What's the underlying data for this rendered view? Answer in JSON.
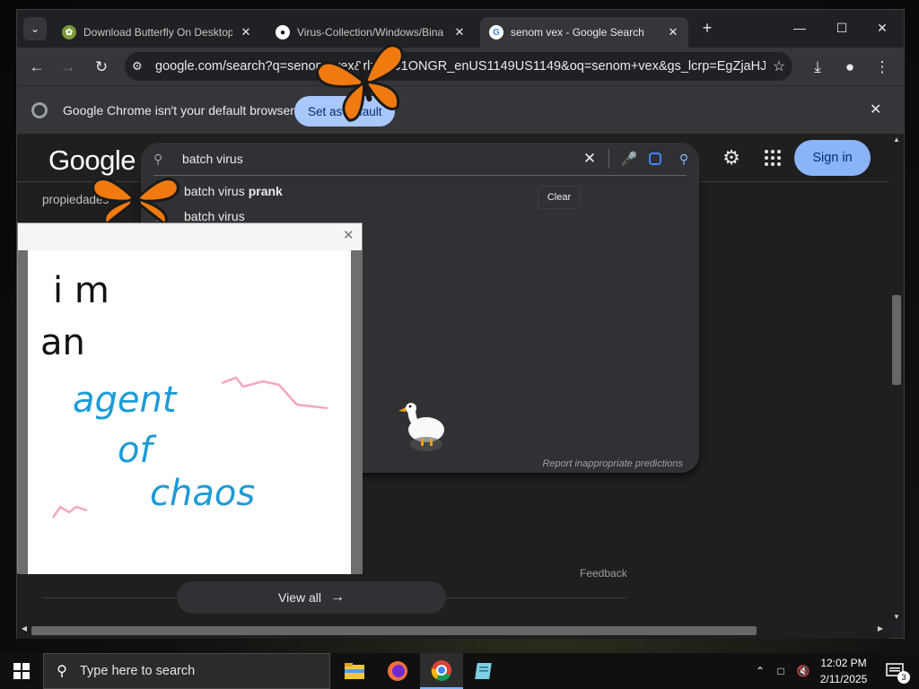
{
  "browser": {
    "tabs": [
      {
        "title": "Download Butterfly On Desktop",
        "favicon": "butterfly-site-icon"
      },
      {
        "title": "Virus-Collection/Windows/Bina",
        "favicon": "github-icon"
      },
      {
        "title": "senom vex - Google Search",
        "favicon": "google-icon",
        "active": true
      }
    ],
    "new_tab_label": "+",
    "address": "google.com/search?q=senom+vex&rlz=1C1ONGR_enUS1149US1149&oq=senom+vex&gs_lcrp=EgZjaHJv...",
    "infobar": {
      "message": "Google Chrome isn't your default browser",
      "button": "Set as default"
    }
  },
  "page": {
    "logo": "Google",
    "query": "batch virus",
    "clear_tooltip": "Clear",
    "suggestions": [
      {
        "prefix": "batch virus",
        "bold": "prank"
      },
      {
        "prefix": "batch virus",
        "bold": ""
      }
    ],
    "report": "Report inappropriate predictions",
    "sign_in": "Sign in",
    "propiedades": "propiedades",
    "feedback": "Feedback",
    "view_all": "View all"
  },
  "doodle": {
    "lines": [
      "i  m",
      "an",
      "agent",
      "of",
      "chaos"
    ]
  },
  "taskbar": {
    "search_placeholder": "Type here to search",
    "time": "12:02 PM",
    "date": "2/11/2025",
    "notification_count": "3"
  },
  "colors": {
    "accent": "#8ab4f8",
    "butterfly": "#f07a10",
    "doodle_blue": "#1e9bd7",
    "doodle_pink": "#f4a6bf"
  }
}
